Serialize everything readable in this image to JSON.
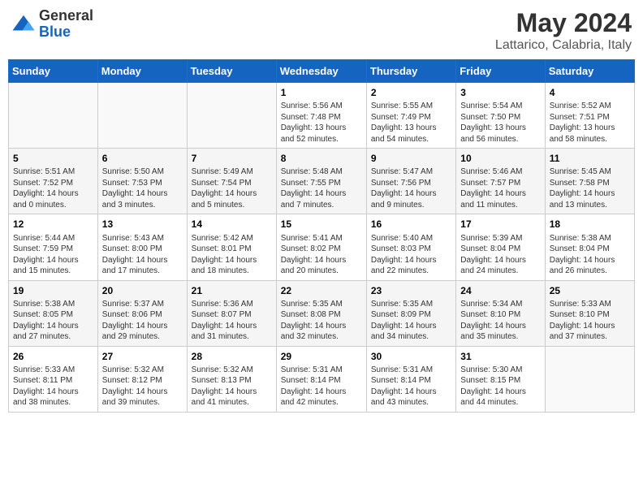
{
  "header": {
    "logo_general": "General",
    "logo_blue": "Blue",
    "month_year": "May 2024",
    "location": "Lattarico, Calabria, Italy"
  },
  "weekdays": [
    "Sunday",
    "Monday",
    "Tuesday",
    "Wednesday",
    "Thursday",
    "Friday",
    "Saturday"
  ],
  "weeks": [
    [
      {
        "day": "",
        "info": ""
      },
      {
        "day": "",
        "info": ""
      },
      {
        "day": "",
        "info": ""
      },
      {
        "day": "1",
        "info": "Sunrise: 5:56 AM\nSunset: 7:48 PM\nDaylight: 13 hours\nand 52 minutes."
      },
      {
        "day": "2",
        "info": "Sunrise: 5:55 AM\nSunset: 7:49 PM\nDaylight: 13 hours\nand 54 minutes."
      },
      {
        "day": "3",
        "info": "Sunrise: 5:54 AM\nSunset: 7:50 PM\nDaylight: 13 hours\nand 56 minutes."
      },
      {
        "day": "4",
        "info": "Sunrise: 5:52 AM\nSunset: 7:51 PM\nDaylight: 13 hours\nand 58 minutes."
      }
    ],
    [
      {
        "day": "5",
        "info": "Sunrise: 5:51 AM\nSunset: 7:52 PM\nDaylight: 14 hours\nand 0 minutes."
      },
      {
        "day": "6",
        "info": "Sunrise: 5:50 AM\nSunset: 7:53 PM\nDaylight: 14 hours\nand 3 minutes."
      },
      {
        "day": "7",
        "info": "Sunrise: 5:49 AM\nSunset: 7:54 PM\nDaylight: 14 hours\nand 5 minutes."
      },
      {
        "day": "8",
        "info": "Sunrise: 5:48 AM\nSunset: 7:55 PM\nDaylight: 14 hours\nand 7 minutes."
      },
      {
        "day": "9",
        "info": "Sunrise: 5:47 AM\nSunset: 7:56 PM\nDaylight: 14 hours\nand 9 minutes."
      },
      {
        "day": "10",
        "info": "Sunrise: 5:46 AM\nSunset: 7:57 PM\nDaylight: 14 hours\nand 11 minutes."
      },
      {
        "day": "11",
        "info": "Sunrise: 5:45 AM\nSunset: 7:58 PM\nDaylight: 14 hours\nand 13 minutes."
      }
    ],
    [
      {
        "day": "12",
        "info": "Sunrise: 5:44 AM\nSunset: 7:59 PM\nDaylight: 14 hours\nand 15 minutes."
      },
      {
        "day": "13",
        "info": "Sunrise: 5:43 AM\nSunset: 8:00 PM\nDaylight: 14 hours\nand 17 minutes."
      },
      {
        "day": "14",
        "info": "Sunrise: 5:42 AM\nSunset: 8:01 PM\nDaylight: 14 hours\nand 18 minutes."
      },
      {
        "day": "15",
        "info": "Sunrise: 5:41 AM\nSunset: 8:02 PM\nDaylight: 14 hours\nand 20 minutes."
      },
      {
        "day": "16",
        "info": "Sunrise: 5:40 AM\nSunset: 8:03 PM\nDaylight: 14 hours\nand 22 minutes."
      },
      {
        "day": "17",
        "info": "Sunrise: 5:39 AM\nSunset: 8:04 PM\nDaylight: 14 hours\nand 24 minutes."
      },
      {
        "day": "18",
        "info": "Sunrise: 5:38 AM\nSunset: 8:04 PM\nDaylight: 14 hours\nand 26 minutes."
      }
    ],
    [
      {
        "day": "19",
        "info": "Sunrise: 5:38 AM\nSunset: 8:05 PM\nDaylight: 14 hours\nand 27 minutes."
      },
      {
        "day": "20",
        "info": "Sunrise: 5:37 AM\nSunset: 8:06 PM\nDaylight: 14 hours\nand 29 minutes."
      },
      {
        "day": "21",
        "info": "Sunrise: 5:36 AM\nSunset: 8:07 PM\nDaylight: 14 hours\nand 31 minutes."
      },
      {
        "day": "22",
        "info": "Sunrise: 5:35 AM\nSunset: 8:08 PM\nDaylight: 14 hours\nand 32 minutes."
      },
      {
        "day": "23",
        "info": "Sunrise: 5:35 AM\nSunset: 8:09 PM\nDaylight: 14 hours\nand 34 minutes."
      },
      {
        "day": "24",
        "info": "Sunrise: 5:34 AM\nSunset: 8:10 PM\nDaylight: 14 hours\nand 35 minutes."
      },
      {
        "day": "25",
        "info": "Sunrise: 5:33 AM\nSunset: 8:10 PM\nDaylight: 14 hours\nand 37 minutes."
      }
    ],
    [
      {
        "day": "26",
        "info": "Sunrise: 5:33 AM\nSunset: 8:11 PM\nDaylight: 14 hours\nand 38 minutes."
      },
      {
        "day": "27",
        "info": "Sunrise: 5:32 AM\nSunset: 8:12 PM\nDaylight: 14 hours\nand 39 minutes."
      },
      {
        "day": "28",
        "info": "Sunrise: 5:32 AM\nSunset: 8:13 PM\nDaylight: 14 hours\nand 41 minutes."
      },
      {
        "day": "29",
        "info": "Sunrise: 5:31 AM\nSunset: 8:14 PM\nDaylight: 14 hours\nand 42 minutes."
      },
      {
        "day": "30",
        "info": "Sunrise: 5:31 AM\nSunset: 8:14 PM\nDaylight: 14 hours\nand 43 minutes."
      },
      {
        "day": "31",
        "info": "Sunrise: 5:30 AM\nSunset: 8:15 PM\nDaylight: 14 hours\nand 44 minutes."
      },
      {
        "day": "",
        "info": ""
      }
    ]
  ]
}
